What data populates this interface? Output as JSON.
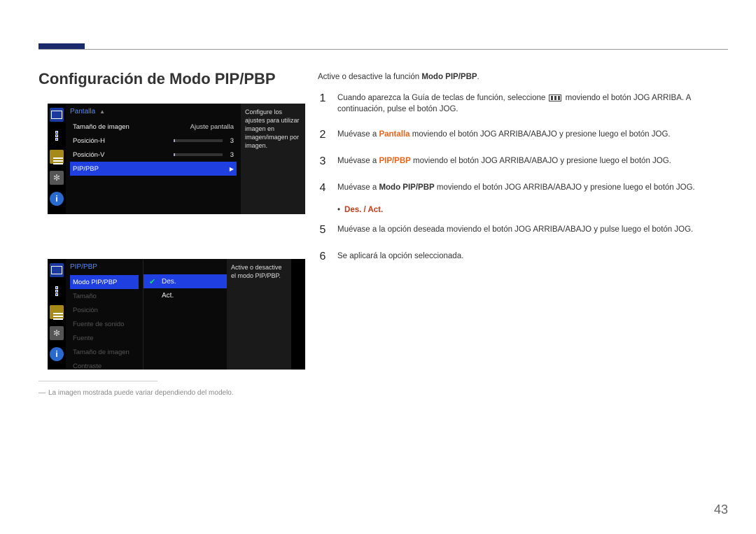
{
  "page": {
    "title": "Configuración de Modo PIP/PBP",
    "number": "43",
    "footnote_dash": "―",
    "footnote": "La imagen mostrada puede variar dependiendo del modelo."
  },
  "osd1": {
    "header": "Pantalla",
    "desc": "Configure los ajustes para utilizar imagen en imagen/imagen por imagen.",
    "rows": [
      {
        "label": "Tamaño de imagen",
        "value": "Ajuste pantalla",
        "type": "text"
      },
      {
        "label": "Posición-H",
        "value": "3",
        "type": "slider",
        "fill": 3
      },
      {
        "label": "Posición-V",
        "value": "3",
        "type": "slider",
        "fill": 3
      },
      {
        "label": "PIP/PBP",
        "type": "nav",
        "selected": true
      }
    ]
  },
  "osd2": {
    "header": "PIP/PBP",
    "desc": "Active o desactive el modo PIP/PBP.",
    "rows": [
      {
        "label": "Modo PIP/PBP",
        "selected": true
      },
      {
        "label": "Tamaño",
        "dim": true
      },
      {
        "label": "Posición",
        "dim": true
      },
      {
        "label": "Fuente de sonido",
        "dim": true
      },
      {
        "label": "Fuente",
        "dim": true
      },
      {
        "label": "Tamaño de imagen",
        "dim": true
      },
      {
        "label": "Contraste",
        "dim": true
      }
    ],
    "submenu": {
      "options": [
        {
          "label": "Des.",
          "checked": true,
          "selected": true
        },
        {
          "label": "Act.",
          "checked": false,
          "selected": false
        }
      ]
    }
  },
  "intro": {
    "prefix": "Active o desactive la función ",
    "bold": "Modo PIP/PBP",
    "suffix": "."
  },
  "steps": {
    "s1": {
      "num": "1",
      "t_a": "Cuando aparezca la Guía de teclas de función, seleccione ",
      "t_b": " moviendo el botón JOG ARRIBA. A continuación, pulse el botón JOG."
    },
    "s2": {
      "num": "2",
      "t_a": "Muévase a ",
      "hl": "Pantalla",
      "t_b": " moviendo el botón JOG ARRIBA/ABAJO y presione luego el botón JOG."
    },
    "s3": {
      "num": "3",
      "t_a": "Muévase a ",
      "hl": "PIP/PBP",
      "t_b": " moviendo el botón JOG ARRIBA/ABAJO y presione luego el botón JOG."
    },
    "s4": {
      "num": "4",
      "t_a": "Muévase a ",
      "hl": "Modo PIP/PBP",
      "t_b": " moviendo el botón JOG ARRIBA/ABAJO y presione luego el botón JOG."
    },
    "opts": {
      "dot": "•",
      "text": "Des. / Act."
    },
    "s5": {
      "num": "5",
      "text": "Muévase a la opción deseada moviendo el botón JOG ARRIBA/ABAJO y pulse luego el botón JOG."
    },
    "s6": {
      "num": "6",
      "text": "Se aplicará la opción seleccionada."
    }
  }
}
